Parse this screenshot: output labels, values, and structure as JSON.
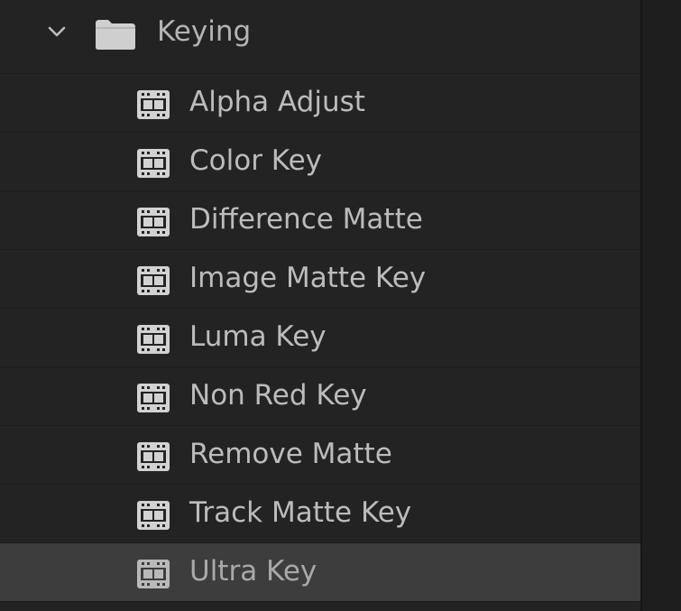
{
  "tree": {
    "folder": {
      "label": "Keying",
      "expanded": true,
      "chevron_icon": "chevron-down-icon",
      "icon": "folder-icon"
    },
    "effect_icon": "video-effect-icon",
    "items": [
      {
        "label": "Alpha Adjust"
      },
      {
        "label": "Color Key"
      },
      {
        "label": "Difference Matte"
      },
      {
        "label": "Image Matte Key"
      },
      {
        "label": "Luma Key"
      },
      {
        "label": "Non Red Key"
      },
      {
        "label": "Remove Matte"
      },
      {
        "label": "Track Matte Key"
      },
      {
        "label": "Ultra Key",
        "selected": true
      }
    ]
  },
  "colors": {
    "panel_bg": "#232323",
    "selected_bg": "#3d3d3d",
    "text": "#bcbcbc",
    "icon": "#d2d2d2"
  }
}
